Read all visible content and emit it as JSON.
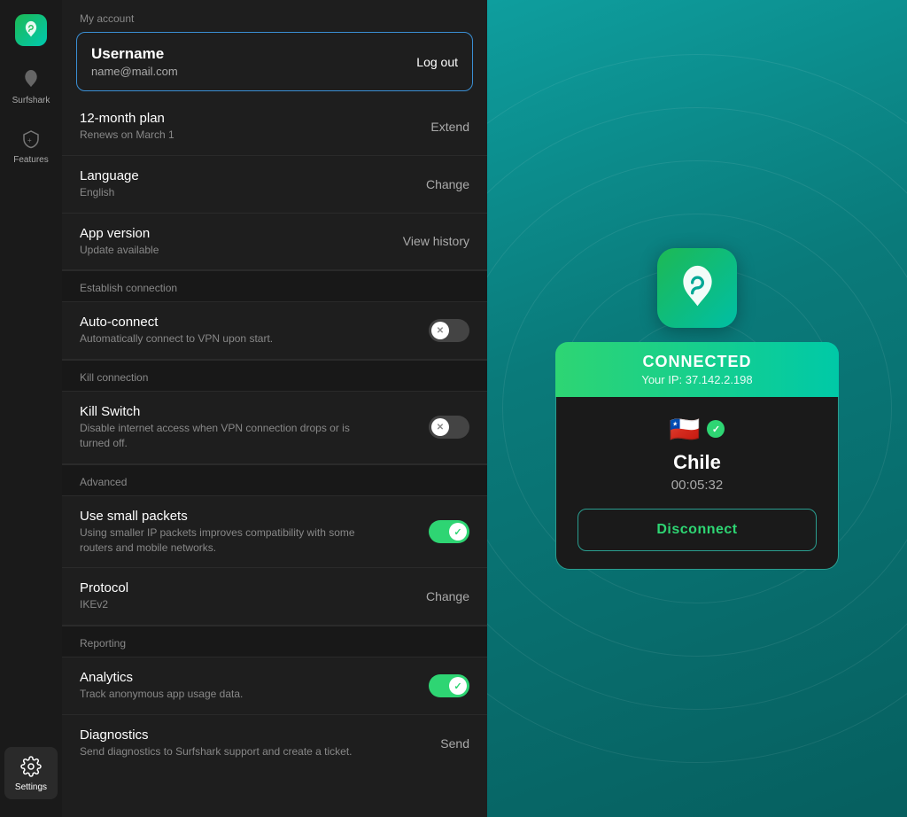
{
  "sidebar": {
    "app_name": "Surfshark",
    "items": [
      {
        "id": "surfshark",
        "label": "Surfshark",
        "icon": "surfshark-icon"
      },
      {
        "id": "features",
        "label": "Features",
        "icon": "shield-icon"
      },
      {
        "id": "settings",
        "label": "Settings",
        "icon": "gear-icon",
        "active": true
      }
    ]
  },
  "settings": {
    "section_account": "My account",
    "account": {
      "username": "Username",
      "email": "name@mail.com",
      "logout_label": "Log out"
    },
    "plan": {
      "title": "12-month plan",
      "subtitle": "Renews on March 1",
      "action": "Extend"
    },
    "language": {
      "title": "Language",
      "subtitle": "English",
      "action": "Change"
    },
    "app_version": {
      "title": "App version",
      "subtitle": "Update available",
      "action": "View history"
    },
    "section_connection": "Establish connection",
    "auto_connect": {
      "title": "Auto-connect",
      "subtitle": "Automatically connect to VPN upon start.",
      "toggle": "off"
    },
    "section_kill": "Kill connection",
    "kill_switch": {
      "title": "Kill Switch",
      "subtitle": "Disable internet access when VPN connection drops or is turned off.",
      "toggle": "off"
    },
    "section_advanced": "Advanced",
    "small_packets": {
      "title": "Use small packets",
      "subtitle": "Using smaller IP packets improves compatibility with some routers and mobile networks.",
      "toggle": "on"
    },
    "protocol": {
      "title": "Protocol",
      "subtitle": "IKEv2",
      "action": "Change"
    },
    "section_reporting": "Reporting",
    "analytics": {
      "title": "Analytics",
      "subtitle": "Track anonymous app usage data.",
      "toggle": "on"
    },
    "diagnostics": {
      "title": "Diagnostics",
      "subtitle": "Send diagnostics to Surfshark support and create a ticket.",
      "action": "Send"
    }
  },
  "vpn": {
    "status": "CONNECTED",
    "ip_label": "Your IP: 37.142.2.198",
    "country": "Chile",
    "flag": "🇨🇱",
    "timer": "00:05:32",
    "disconnect_label": "Disconnect",
    "verified_check": "✓"
  }
}
